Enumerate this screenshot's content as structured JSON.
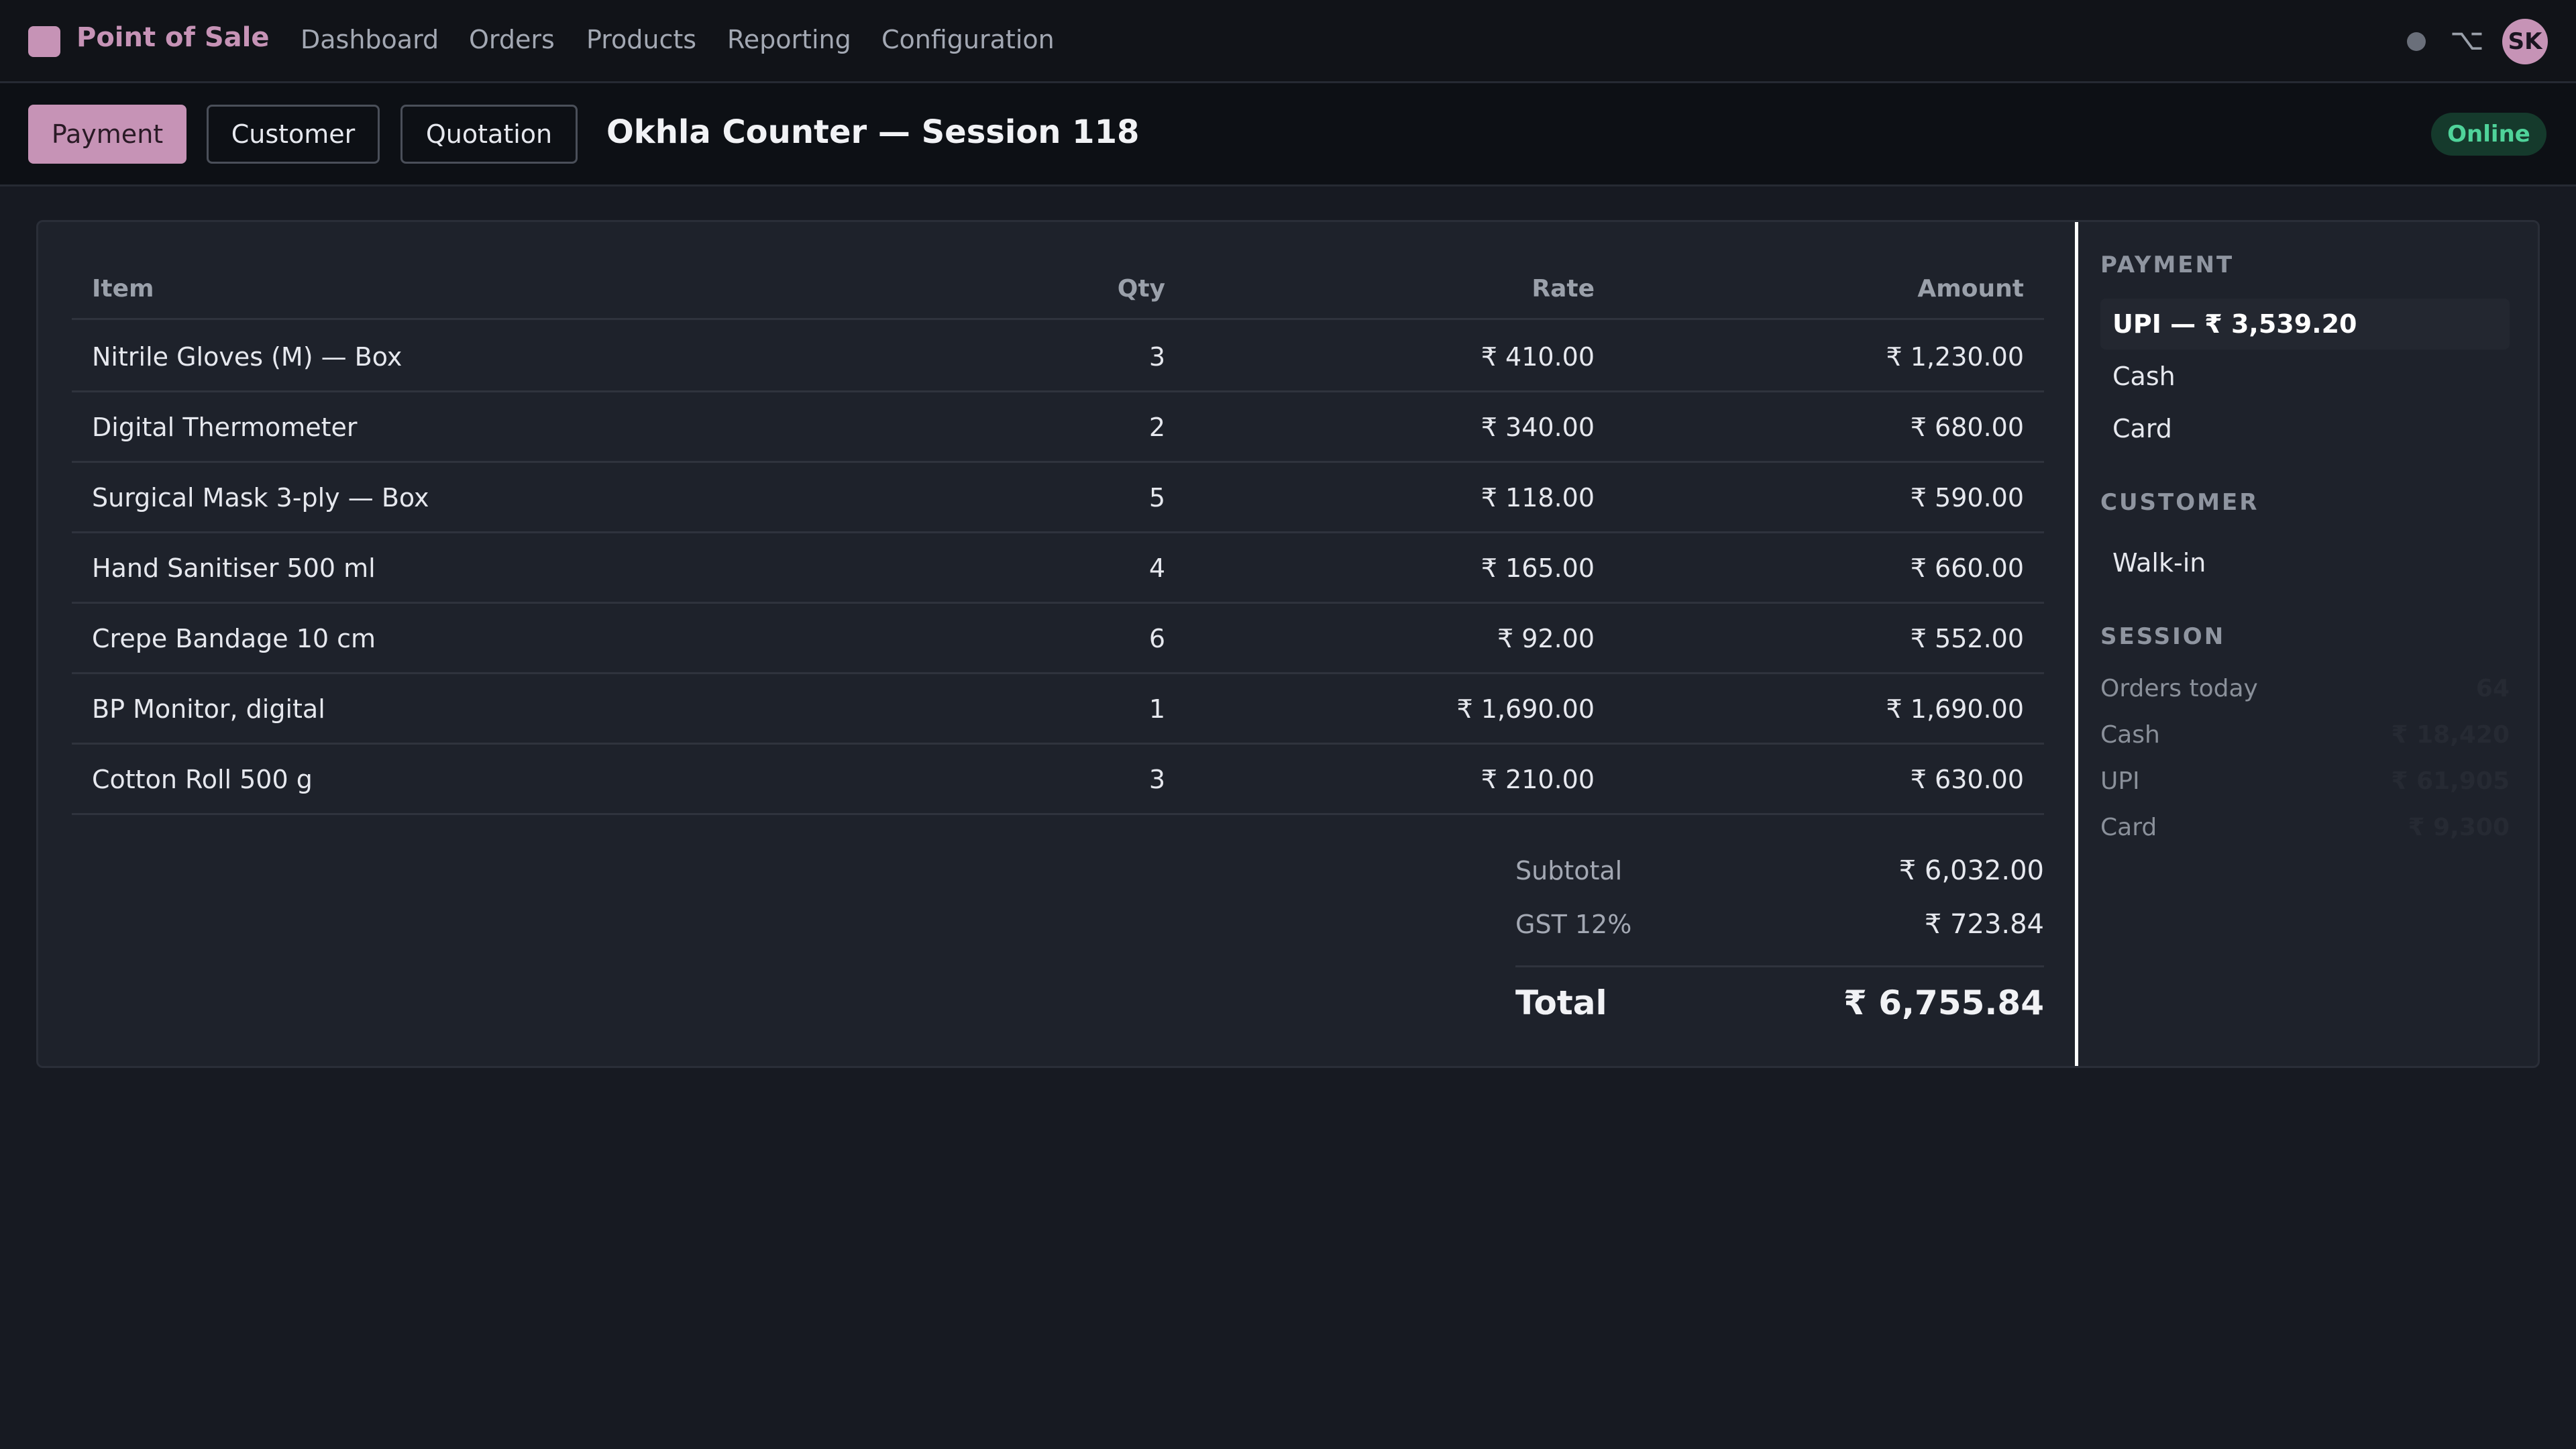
{
  "app": {
    "name": "Point of Sale",
    "nav": [
      "Dashboard",
      "Orders",
      "Products",
      "Reporting",
      "Configuration"
    ],
    "user_initials": "SK",
    "brand_color": "#c693b6"
  },
  "toolbar": {
    "modes": [
      "Payment",
      "Customer",
      "Quotation"
    ],
    "active_mode": "Payment",
    "session_title": "Okhla Counter — Session 118",
    "status": "Online"
  },
  "order": {
    "columns": [
      "Item",
      "Qty",
      "Rate",
      "Amount"
    ],
    "lines": [
      {
        "item": "Nitrile Gloves (M) — Box",
        "qty": "3",
        "rate": "₹ 410.00",
        "amount": "₹ 1,230.00"
      },
      {
        "item": "Digital Thermometer",
        "qty": "2",
        "rate": "₹ 340.00",
        "amount": "₹ 680.00"
      },
      {
        "item": "Surgical Mask 3-ply — Box",
        "qty": "5",
        "rate": "₹ 118.00",
        "amount": "₹ 590.00"
      },
      {
        "item": "Hand Sanitiser 500 ml",
        "qty": "4",
        "rate": "₹ 165.00",
        "amount": "₹ 660.00"
      },
      {
        "item": "Crepe Bandage 10 cm",
        "qty": "6",
        "rate": "₹ 92.00",
        "amount": "₹ 552.00"
      },
      {
        "item": "BP Monitor, digital",
        "qty": "1",
        "rate": "₹ 1,690.00",
        "amount": "₹ 1,690.00"
      },
      {
        "item": "Cotton Roll 500 g",
        "qty": "3",
        "rate": "₹ 210.00",
        "amount": "₹ 630.00"
      }
    ],
    "subtotal_label": "Subtotal",
    "subtotal": "₹ 6,032.00",
    "tax_label": "GST 12%",
    "tax": "₹ 723.84",
    "total_label": "Total",
    "total": "₹ 6,755.84"
  },
  "side": {
    "payment_heading": "PAYMENT",
    "payment_options": [
      "UPI — ₹ 3,539.20",
      "Cash",
      "Card"
    ],
    "customer_heading": "CUSTOMER",
    "customer": "Walk-in",
    "session_heading": "SESSION",
    "session_stats": [
      {
        "label": "Orders today",
        "value": "64"
      },
      {
        "label": "Cash",
        "value": "₹ 18,420"
      },
      {
        "label": "UPI",
        "value": "₹ 61,905"
      },
      {
        "label": "Card",
        "value": "₹ 9,300"
      }
    ]
  }
}
